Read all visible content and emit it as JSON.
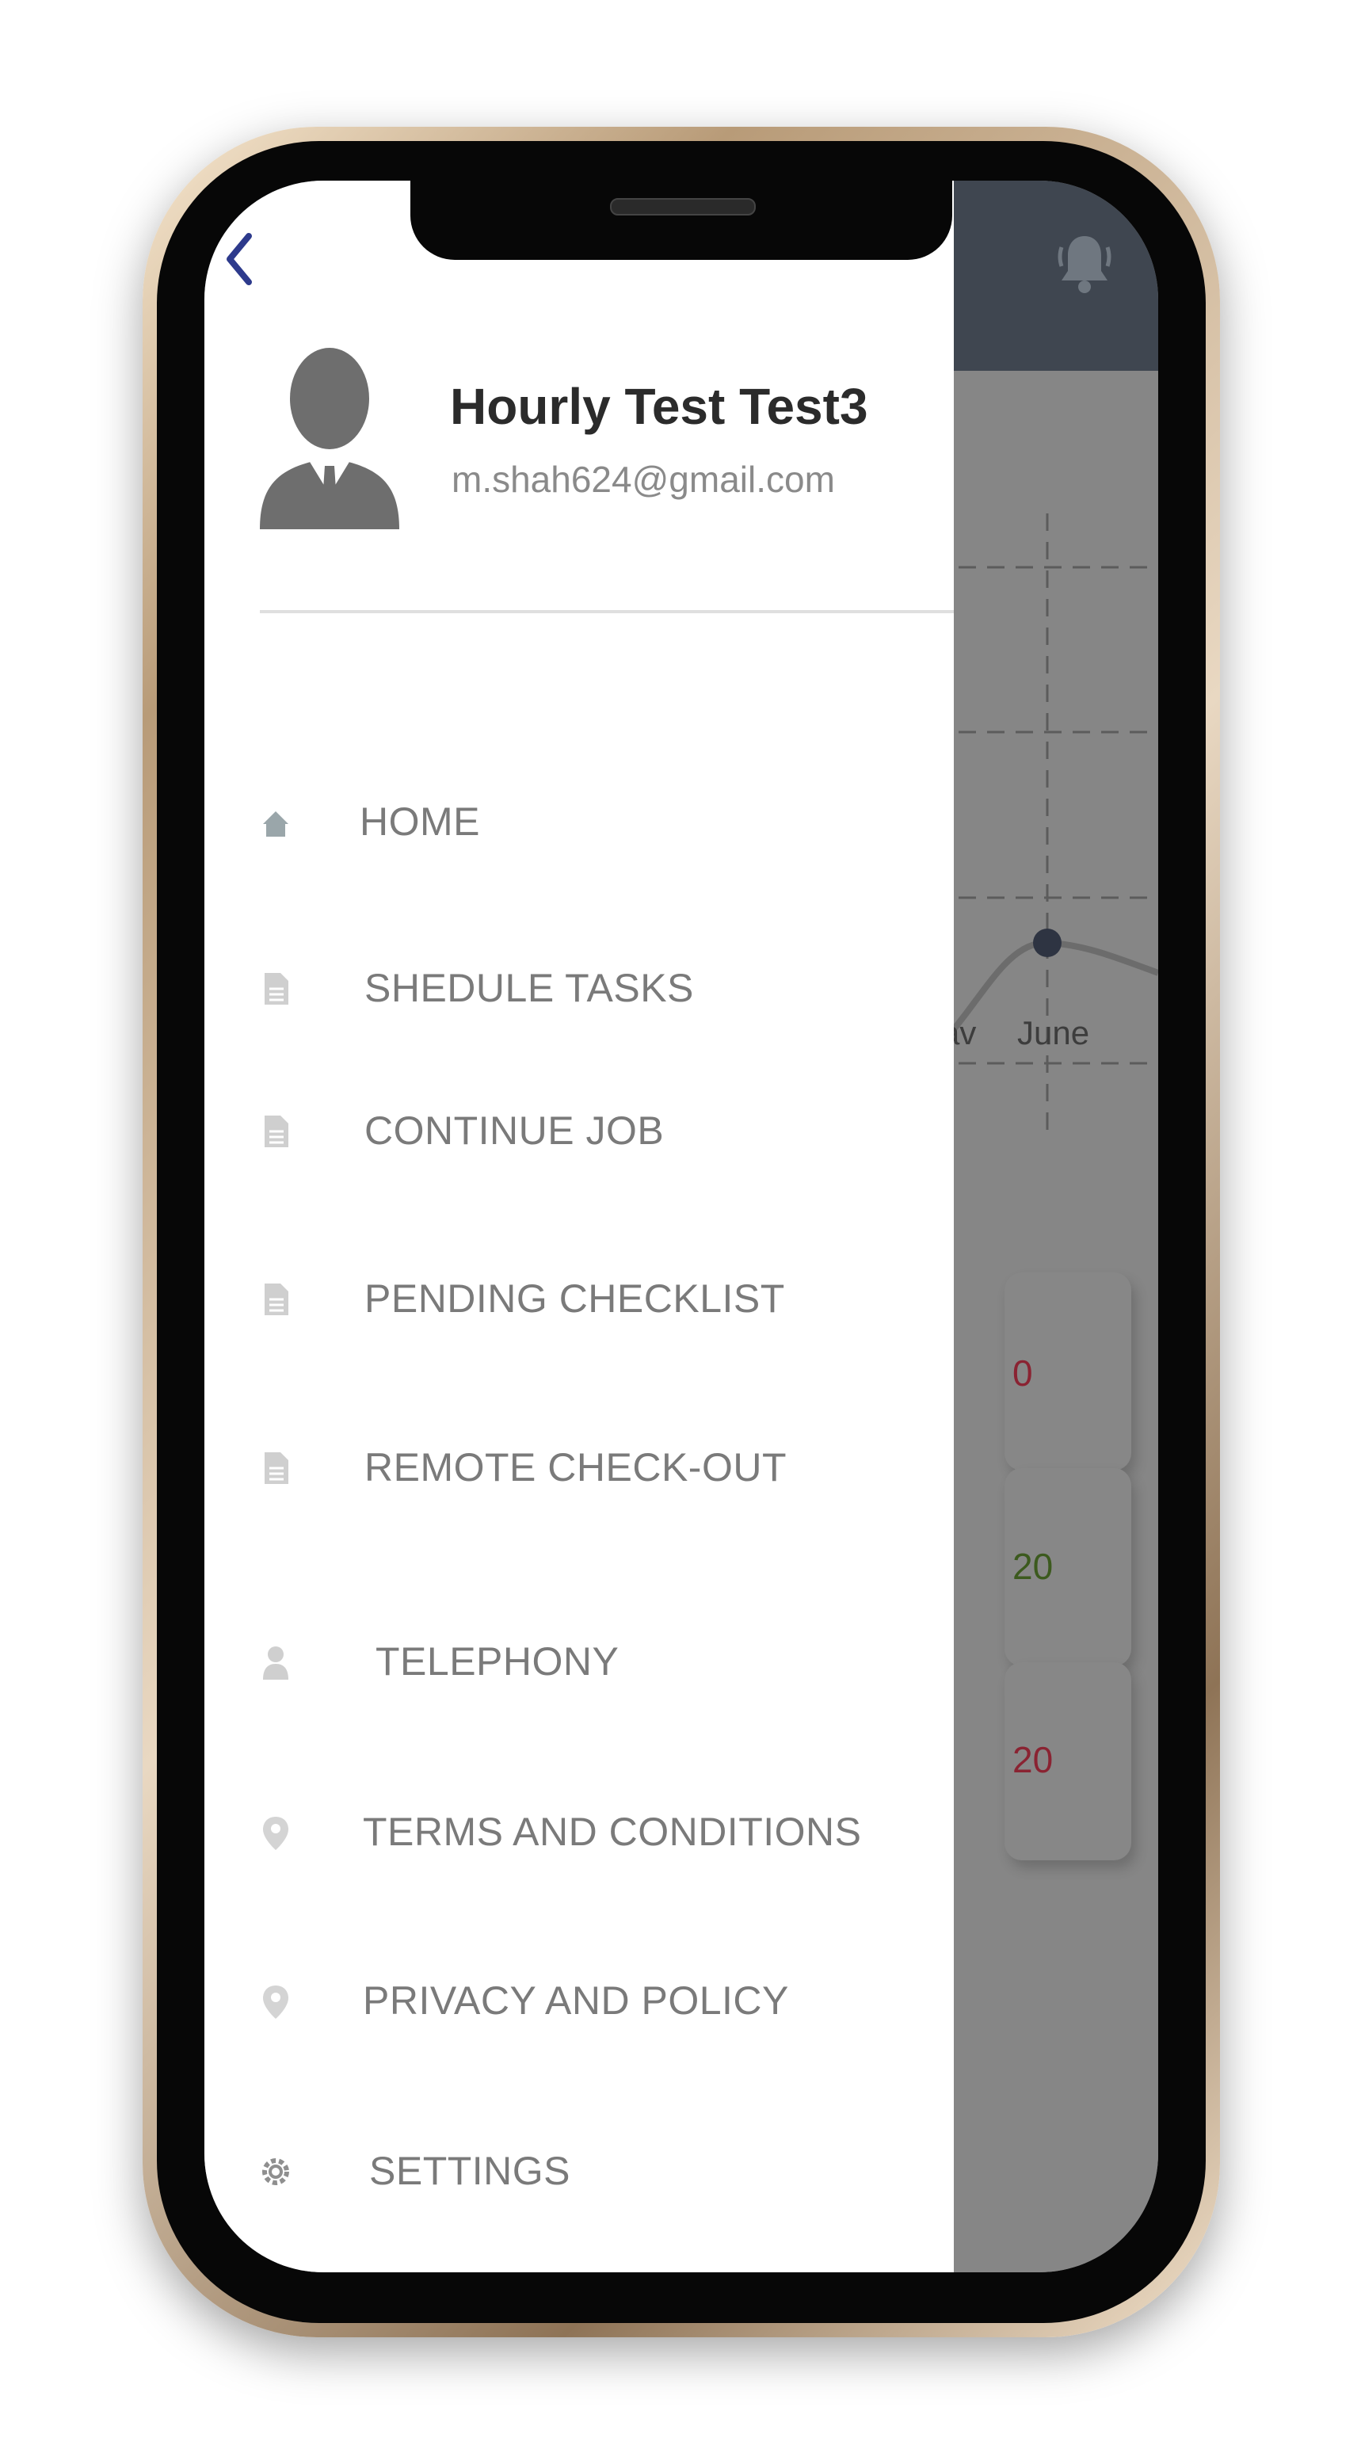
{
  "drawer": {
    "user": {
      "name": "Hourly Test Test3",
      "email": "m.shah624@gmail.com"
    },
    "menu": [
      {
        "label": "HOME",
        "icon": "home-icon"
      },
      {
        "label": "SHEDULE TASKS",
        "icon": "document-icon"
      },
      {
        "label": "CONTINUE JOB",
        "icon": "document-icon"
      },
      {
        "label": "PENDING CHECKLIST",
        "icon": "document-icon"
      },
      {
        "label": "REMOTE CHECK-OUT",
        "icon": "document-icon"
      },
      {
        "label": "TELEPHONY",
        "icon": "person-icon"
      },
      {
        "label": "TERMS AND CONDITIONS",
        "icon": "location-pin-icon"
      },
      {
        "label": "PRIVACY AND POLICY",
        "icon": "location-pin-icon"
      },
      {
        "label": "SETTINGS",
        "icon": "gear-icon"
      }
    ]
  },
  "background": {
    "chart_ticks": [
      "av",
      "June"
    ],
    "stats": [
      {
        "value": "0",
        "color": "#8a2332"
      },
      {
        "value": "20",
        "color": "#3c5a1e"
      },
      {
        "value": "20",
        "color": "#8a2332"
      }
    ]
  },
  "colors": {
    "accent": "#2d3a8c",
    "header": "#3f4650",
    "menu_text": "#7a7a7a"
  }
}
